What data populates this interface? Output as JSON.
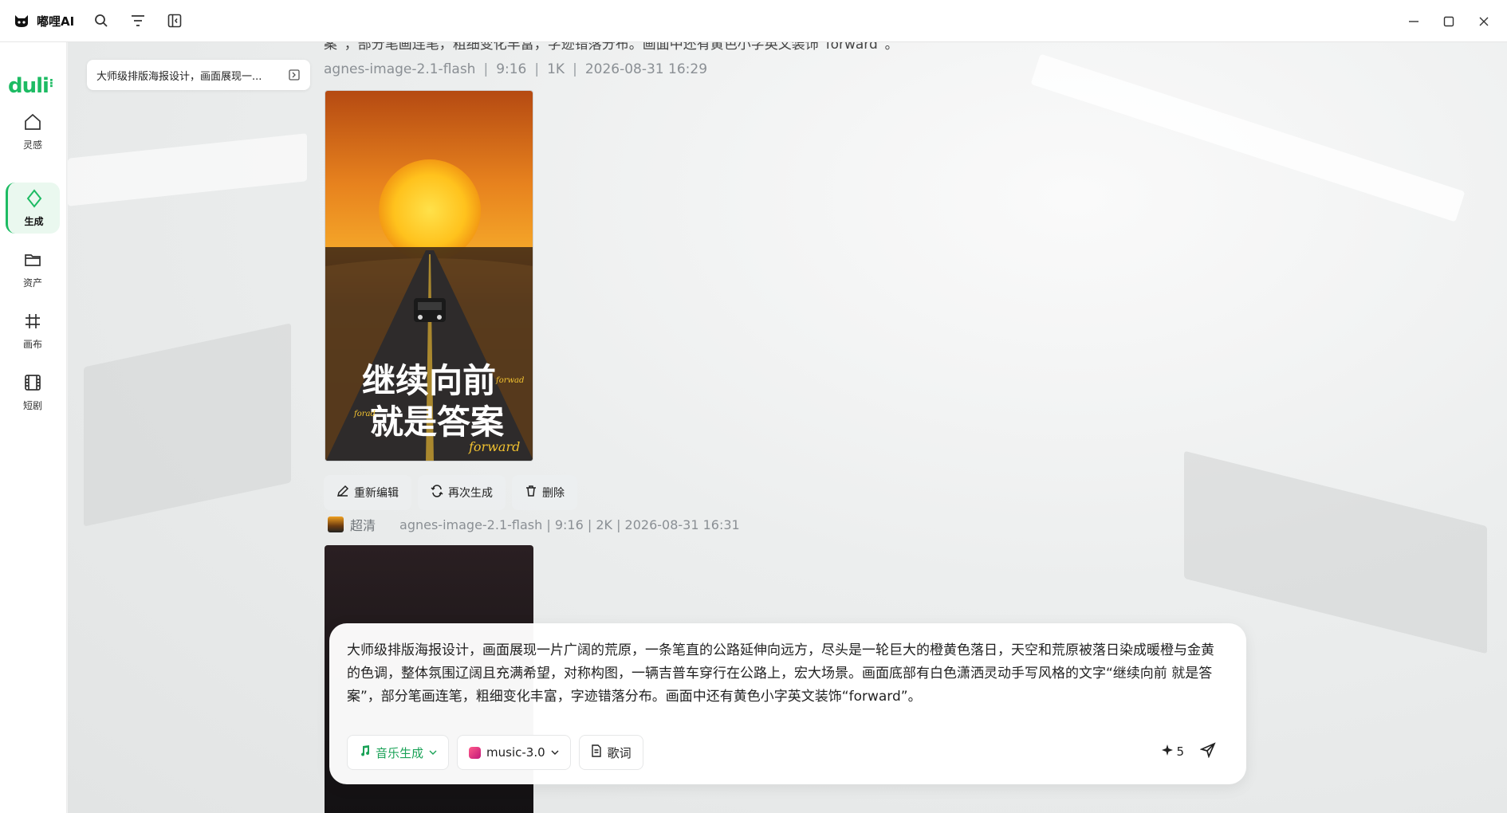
{
  "app": {
    "name": "嘟哩AI",
    "brand": "duli"
  },
  "titlebar": {
    "icons": [
      "search-icon",
      "filter-icon",
      "sidebar-toggle-icon"
    ],
    "window_controls": [
      "minimize-icon",
      "maximize-icon",
      "close-icon"
    ]
  },
  "sidebar": {
    "items": [
      {
        "label": "灵感",
        "icon": "home-icon",
        "active": false
      },
      {
        "label": "生成",
        "icon": "diamond-icon",
        "active": true
      },
      {
        "label": "资产",
        "icon": "folder-icon",
        "active": false
      },
      {
        "label": "画布",
        "icon": "frame-icon",
        "active": false
      },
      {
        "label": "短剧",
        "icon": "film-icon",
        "active": false
      }
    ]
  },
  "chat_chip": {
    "text": "大师级排版海报设计，画面展现一..."
  },
  "history": {
    "cut_text": "案”，部分笔画连笔，粗细变化丰富，字迹错落分布。画面中还有黄色小字英文装饰“forward”。",
    "result1": {
      "model": "agnes-image-2.1-flash",
      "ratio": "9:16",
      "resolution": "1K",
      "time": "2026-08-31 16:29",
      "poster_title_line1": "继续向前",
      "poster_title_line2": "就是答案",
      "poster_deco_1": "forwad",
      "poster_deco_2": "forad",
      "poster_deco_3": "forward"
    },
    "actions": [
      {
        "label": "重新编辑",
        "icon": "pencil-icon"
      },
      {
        "label": "再次生成",
        "icon": "refresh-icon"
      },
      {
        "label": "删除",
        "icon": "trash-icon"
      }
    ],
    "result2": {
      "quality": "超清",
      "info": "agnes-image-2.1-flash | 9:16 | 2K | 2026-08-31 16:31"
    }
  },
  "composer": {
    "prompt": "大师级排版海报设计，画面展现一片广阔的荒原，一条笔直的公路延伸向远方，尽头是一轮巨大的橙黄色落日，天空和荒原被落日染成暖橙与金黄的色调，整体氛围辽阔且充满希望，对称构图，一辆吉普车穿行在公路上，宏大场景。画面底部有白色潇洒灵动手写风格的文字“继续向前 就是答案”，部分笔画连笔，粗细变化丰富，字迹错落分布。画面中还有黄色小字英文装饰“forward”。",
    "mode": "音乐生成",
    "model": "music-3.0",
    "lyrics": "歌词",
    "credits": "5"
  },
  "colors": {
    "accent": "#1dbb63",
    "accent_text": "#1aa257"
  }
}
